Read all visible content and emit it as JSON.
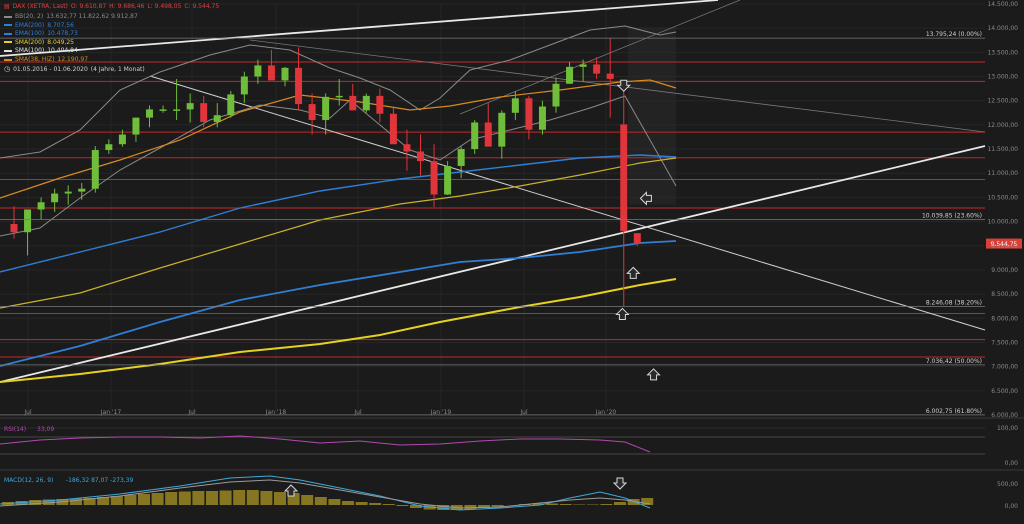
{
  "chart_data": {
    "type": "candlestick",
    "instrument": "DAX (XETRA, Last)",
    "quote": {
      "o": "O: 9.610,87",
      "h": "H: 9.686,46",
      "l": "L: 9.498,05",
      "c": "C: 9.544,75",
      "last": "9.544,75"
    },
    "period": "01.05.2016 - 01.06.2020",
    "period_note": "(4 Jahre, 1 Monat)",
    "legend": [
      {
        "label": "BB(20, 2)",
        "values": "13.632,77   11.822,62   9.912,87",
        "color": "#8a8a8a"
      },
      {
        "label": "EMA(200)",
        "values": "8.707,56",
        "color": "#2f7fd6"
      },
      {
        "label": "EMA(100)",
        "values": "10.478,73",
        "color": "#2f7fd6"
      },
      {
        "label": "SMA(200)",
        "values": "8.049,25",
        "color": "#e6d21e"
      },
      {
        "label": "SMA(100)",
        "values": "10.404,84",
        "color": "#e0e0e0"
      },
      {
        "label": "SMA(38, HiZ)",
        "values": "12.190,97",
        "color": "#d88a1e"
      }
    ],
    "ylim": [
      6000,
      14500
    ],
    "y_ticks": [
      "14.500,00",
      "14.000,00",
      "13.500,00",
      "13.000,00",
      "12.500,00",
      "12.000,00",
      "11.500,00",
      "11.000,00",
      "10.500,00",
      "10.000,00",
      "9.500,00",
      "9.000,00",
      "8.500,00",
      "8.000,00",
      "7.500,00",
      "7.000,00",
      "6.500,00",
      "6.000,00"
    ],
    "x_ticks": [
      "Jul",
      "Jan '17",
      "Jul",
      "Jan '18",
      "Jul",
      "Jan '19",
      "Jul",
      "Jan '20"
    ],
    "fib_labels": [
      {
        "label": "13.795,24 (0.00%)",
        "value": 13795
      },
      {
        "label": "10.039,85 (23.60%)",
        "value": 10040
      },
      {
        "label": "8.246,08 (38.20%)",
        "value": 8246
      },
      {
        "label": "7.036,42 (50.00%)",
        "value": 7036
      },
      {
        "label": "6.002,75 (61.80%)",
        "value": 6003
      }
    ],
    "red_levels": [
      13300,
      12900,
      11850,
      11320,
      10870,
      10280,
      8100,
      7560,
      7200
    ],
    "candles": [
      {
        "o": 9950,
        "h": 10320,
        "l": 9650,
        "c": 9780
      },
      {
        "o": 9780,
        "h": 10200,
        "l": 9300,
        "c": 10250
      },
      {
        "o": 10250,
        "h": 10500,
        "l": 10050,
        "c": 10400
      },
      {
        "o": 10400,
        "h": 10680,
        "l": 10200,
        "c": 10580
      },
      {
        "o": 10580,
        "h": 10750,
        "l": 10350,
        "c": 10620
      },
      {
        "o": 10620,
        "h": 10800,
        "l": 10450,
        "c": 10680
      },
      {
        "o": 10680,
        "h": 11560,
        "l": 10600,
        "c": 11480
      },
      {
        "o": 11480,
        "h": 11700,
        "l": 11400,
        "c": 11600
      },
      {
        "o": 11600,
        "h": 11900,
        "l": 11550,
        "c": 11800
      },
      {
        "o": 11800,
        "h": 12150,
        "l": 11650,
        "c": 12150
      },
      {
        "o": 12150,
        "h": 12400,
        "l": 11950,
        "c": 12320
      },
      {
        "o": 12320,
        "h": 12400,
        "l": 12250,
        "c": 12320
      },
      {
        "o": 12320,
        "h": 12950,
        "l": 12100,
        "c": 12320
      },
      {
        "o": 12320,
        "h": 12650,
        "l": 12050,
        "c": 12450
      },
      {
        "o": 12450,
        "h": 12600,
        "l": 11950,
        "c": 12060
      },
      {
        "o": 12060,
        "h": 12450,
        "l": 11950,
        "c": 12200
      },
      {
        "o": 12200,
        "h": 12700,
        "l": 12150,
        "c": 12630
      },
      {
        "o": 12630,
        "h": 13100,
        "l": 12450,
        "c": 13000
      },
      {
        "o": 13000,
        "h": 13350,
        "l": 12850,
        "c": 13230
      },
      {
        "o": 13230,
        "h": 13550,
        "l": 12950,
        "c": 12920
      },
      {
        "o": 12920,
        "h": 13200,
        "l": 12800,
        "c": 13180
      },
      {
        "o": 13180,
        "h": 13600,
        "l": 12300,
        "c": 12430
      },
      {
        "o": 12430,
        "h": 12650,
        "l": 11800,
        "c": 12100
      },
      {
        "o": 12100,
        "h": 12650,
        "l": 11800,
        "c": 12580
      },
      {
        "o": 12580,
        "h": 12950,
        "l": 12400,
        "c": 12600
      },
      {
        "o": 12600,
        "h": 12850,
        "l": 12300,
        "c": 12300
      },
      {
        "o": 12300,
        "h": 12650,
        "l": 12250,
        "c": 12600
      },
      {
        "o": 12600,
        "h": 12750,
        "l": 12050,
        "c": 12230
      },
      {
        "o": 12230,
        "h": 12350,
        "l": 11800,
        "c": 11600
      },
      {
        "o": 11600,
        "h": 11900,
        "l": 11050,
        "c": 11450
      },
      {
        "o": 11450,
        "h": 11800,
        "l": 10950,
        "c": 11250
      },
      {
        "o": 11250,
        "h": 11600,
        "l": 10300,
        "c": 10560
      },
      {
        "o": 10560,
        "h": 11250,
        "l": 10550,
        "c": 11150
      },
      {
        "o": 11150,
        "h": 11550,
        "l": 10900,
        "c": 11500
      },
      {
        "o": 11500,
        "h": 12100,
        "l": 11400,
        "c": 12050
      },
      {
        "o": 12050,
        "h": 12450,
        "l": 11750,
        "c": 11550
      },
      {
        "o": 11550,
        "h": 12300,
        "l": 11300,
        "c": 12250
      },
      {
        "o": 12250,
        "h": 12700,
        "l": 12100,
        "c": 12550
      },
      {
        "o": 12550,
        "h": 12600,
        "l": 11700,
        "c": 11900
      },
      {
        "o": 11900,
        "h": 12500,
        "l": 11800,
        "c": 12380
      },
      {
        "o": 12380,
        "h": 12980,
        "l": 12250,
        "c": 12850
      },
      {
        "o": 12850,
        "h": 13300,
        "l": 12850,
        "c": 13200
      },
      {
        "o": 13200,
        "h": 13350,
        "l": 12900,
        "c": 13250
      },
      {
        "o": 13250,
        "h": 13400,
        "l": 12950,
        "c": 13060
      },
      {
        "o": 13060,
        "h": 13800,
        "l": 12150,
        "c": 12950
      },
      {
        "o": 12010,
        "h": 12750,
        "l": 8250,
        "c": 9800
      },
      {
        "o": 9760,
        "h": 9690,
        "l": 9500,
        "c": 9545
      }
    ],
    "arrows": [
      {
        "dir": "down",
        "x": 45,
        "y": 12800
      },
      {
        "dir": "left",
        "x": 46.6,
        "y": 10480
      },
      {
        "dir": "up",
        "x": 45.7,
        "y": 8950
      },
      {
        "dir": "up",
        "x": 44.9,
        "y": 8100
      },
      {
        "dir": "up",
        "x": 47.2,
        "y": 6850
      }
    ],
    "rsi": {
      "label": "RSI(14)",
      "value": "33,09",
      "ticks": [
        "100,00",
        "0,00"
      ]
    },
    "macd": {
      "label": "MACD(12, 26, 9)",
      "values": "-186,32   87,07   -273,39",
      "ticks": [
        "500,00",
        "0,00"
      ]
    }
  }
}
